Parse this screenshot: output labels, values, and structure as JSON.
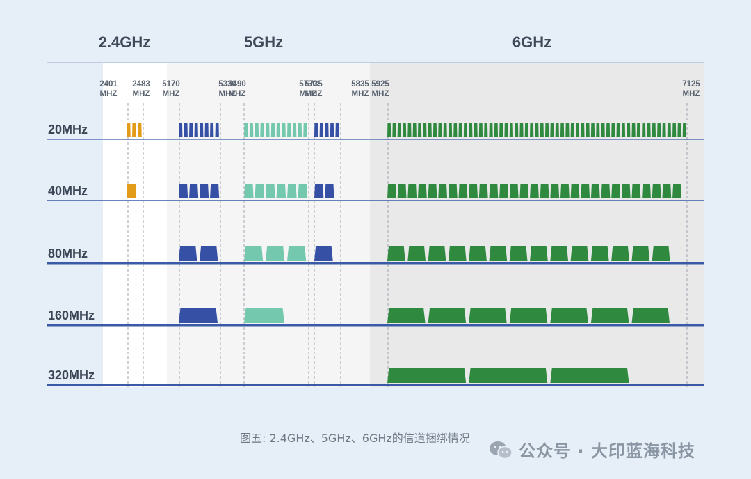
{
  "colors": {
    "band_2_4": "#e39c1a",
    "band_5_dark": "#3550a4",
    "band_5_light": "#74c8ad",
    "band_6": "#2f8a3f",
    "axis_line": "#3a5aa8",
    "background": "#e6eff8"
  },
  "chart_data": {
    "type": "bar",
    "bands": [
      {
        "name": "2.4GHz"
      },
      {
        "name": "5GHz"
      },
      {
        "name": "6GHz"
      }
    ],
    "frequency_markers": [
      {
        "value": 2401,
        "label": "2401",
        "unit": "MHZ"
      },
      {
        "value": 2483,
        "label": "2483",
        "unit": "MHZ"
      },
      {
        "value": 5170,
        "label": "5170",
        "unit": "MHZ"
      },
      {
        "value": 5330,
        "label": "5330",
        "unit": "MHZ"
      },
      {
        "value": 5490,
        "label": "5490",
        "unit": "MHZ"
      },
      {
        "value": 5730,
        "label": "5730",
        "unit": "MHZ"
      },
      {
        "value": 5735,
        "label": "5735",
        "unit": "MHZ"
      },
      {
        "value": 5835,
        "label": "5835",
        "unit": "MHZ"
      },
      {
        "value": 5925,
        "label": "5925",
        "unit": "MHZ"
      },
      {
        "value": 7125,
        "label": "7125",
        "unit": "MHZ"
      }
    ],
    "rows": [
      {
        "label": "20MHz",
        "channels": {
          "2.4GHz": 3,
          "5GHz_UNII1_2": 8,
          "5GHz_UNII2C": 12,
          "5GHz_UNII3": 5,
          "6GHz": 59
        }
      },
      {
        "label": "40MHz",
        "channels": {
          "2.4GHz": 1,
          "5GHz_UNII1_2": 4,
          "5GHz_UNII2C": 6,
          "5GHz_UNII3": 2,
          "6GHz": 29
        }
      },
      {
        "label": "80MHz",
        "channels": {
          "2.4GHz": 0,
          "5GHz_UNII1_2": 2,
          "5GHz_UNII2C": 3,
          "5GHz_UNII3": 1,
          "6GHz": 14
        }
      },
      {
        "label": "160MHz",
        "channels": {
          "2.4GHz": 0,
          "5GHz_UNII1_2": 1,
          "5GHz_UNII2C": 1,
          "5GHz_UNII3": 0,
          "6GHz": 7
        }
      },
      {
        "label": "320MHz",
        "channels": {
          "2.4GHz": 0,
          "5GHz_UNII1_2": 0,
          "5GHz_UNII2C": 0,
          "5GHz_UNII3": 0,
          "6GHz": 3
        }
      }
    ]
  },
  "caption": "图五: 2.4GHz、5GHz、6GHz的信道捆绑情况",
  "watermark": "公众号 · 大印蓝海科技"
}
